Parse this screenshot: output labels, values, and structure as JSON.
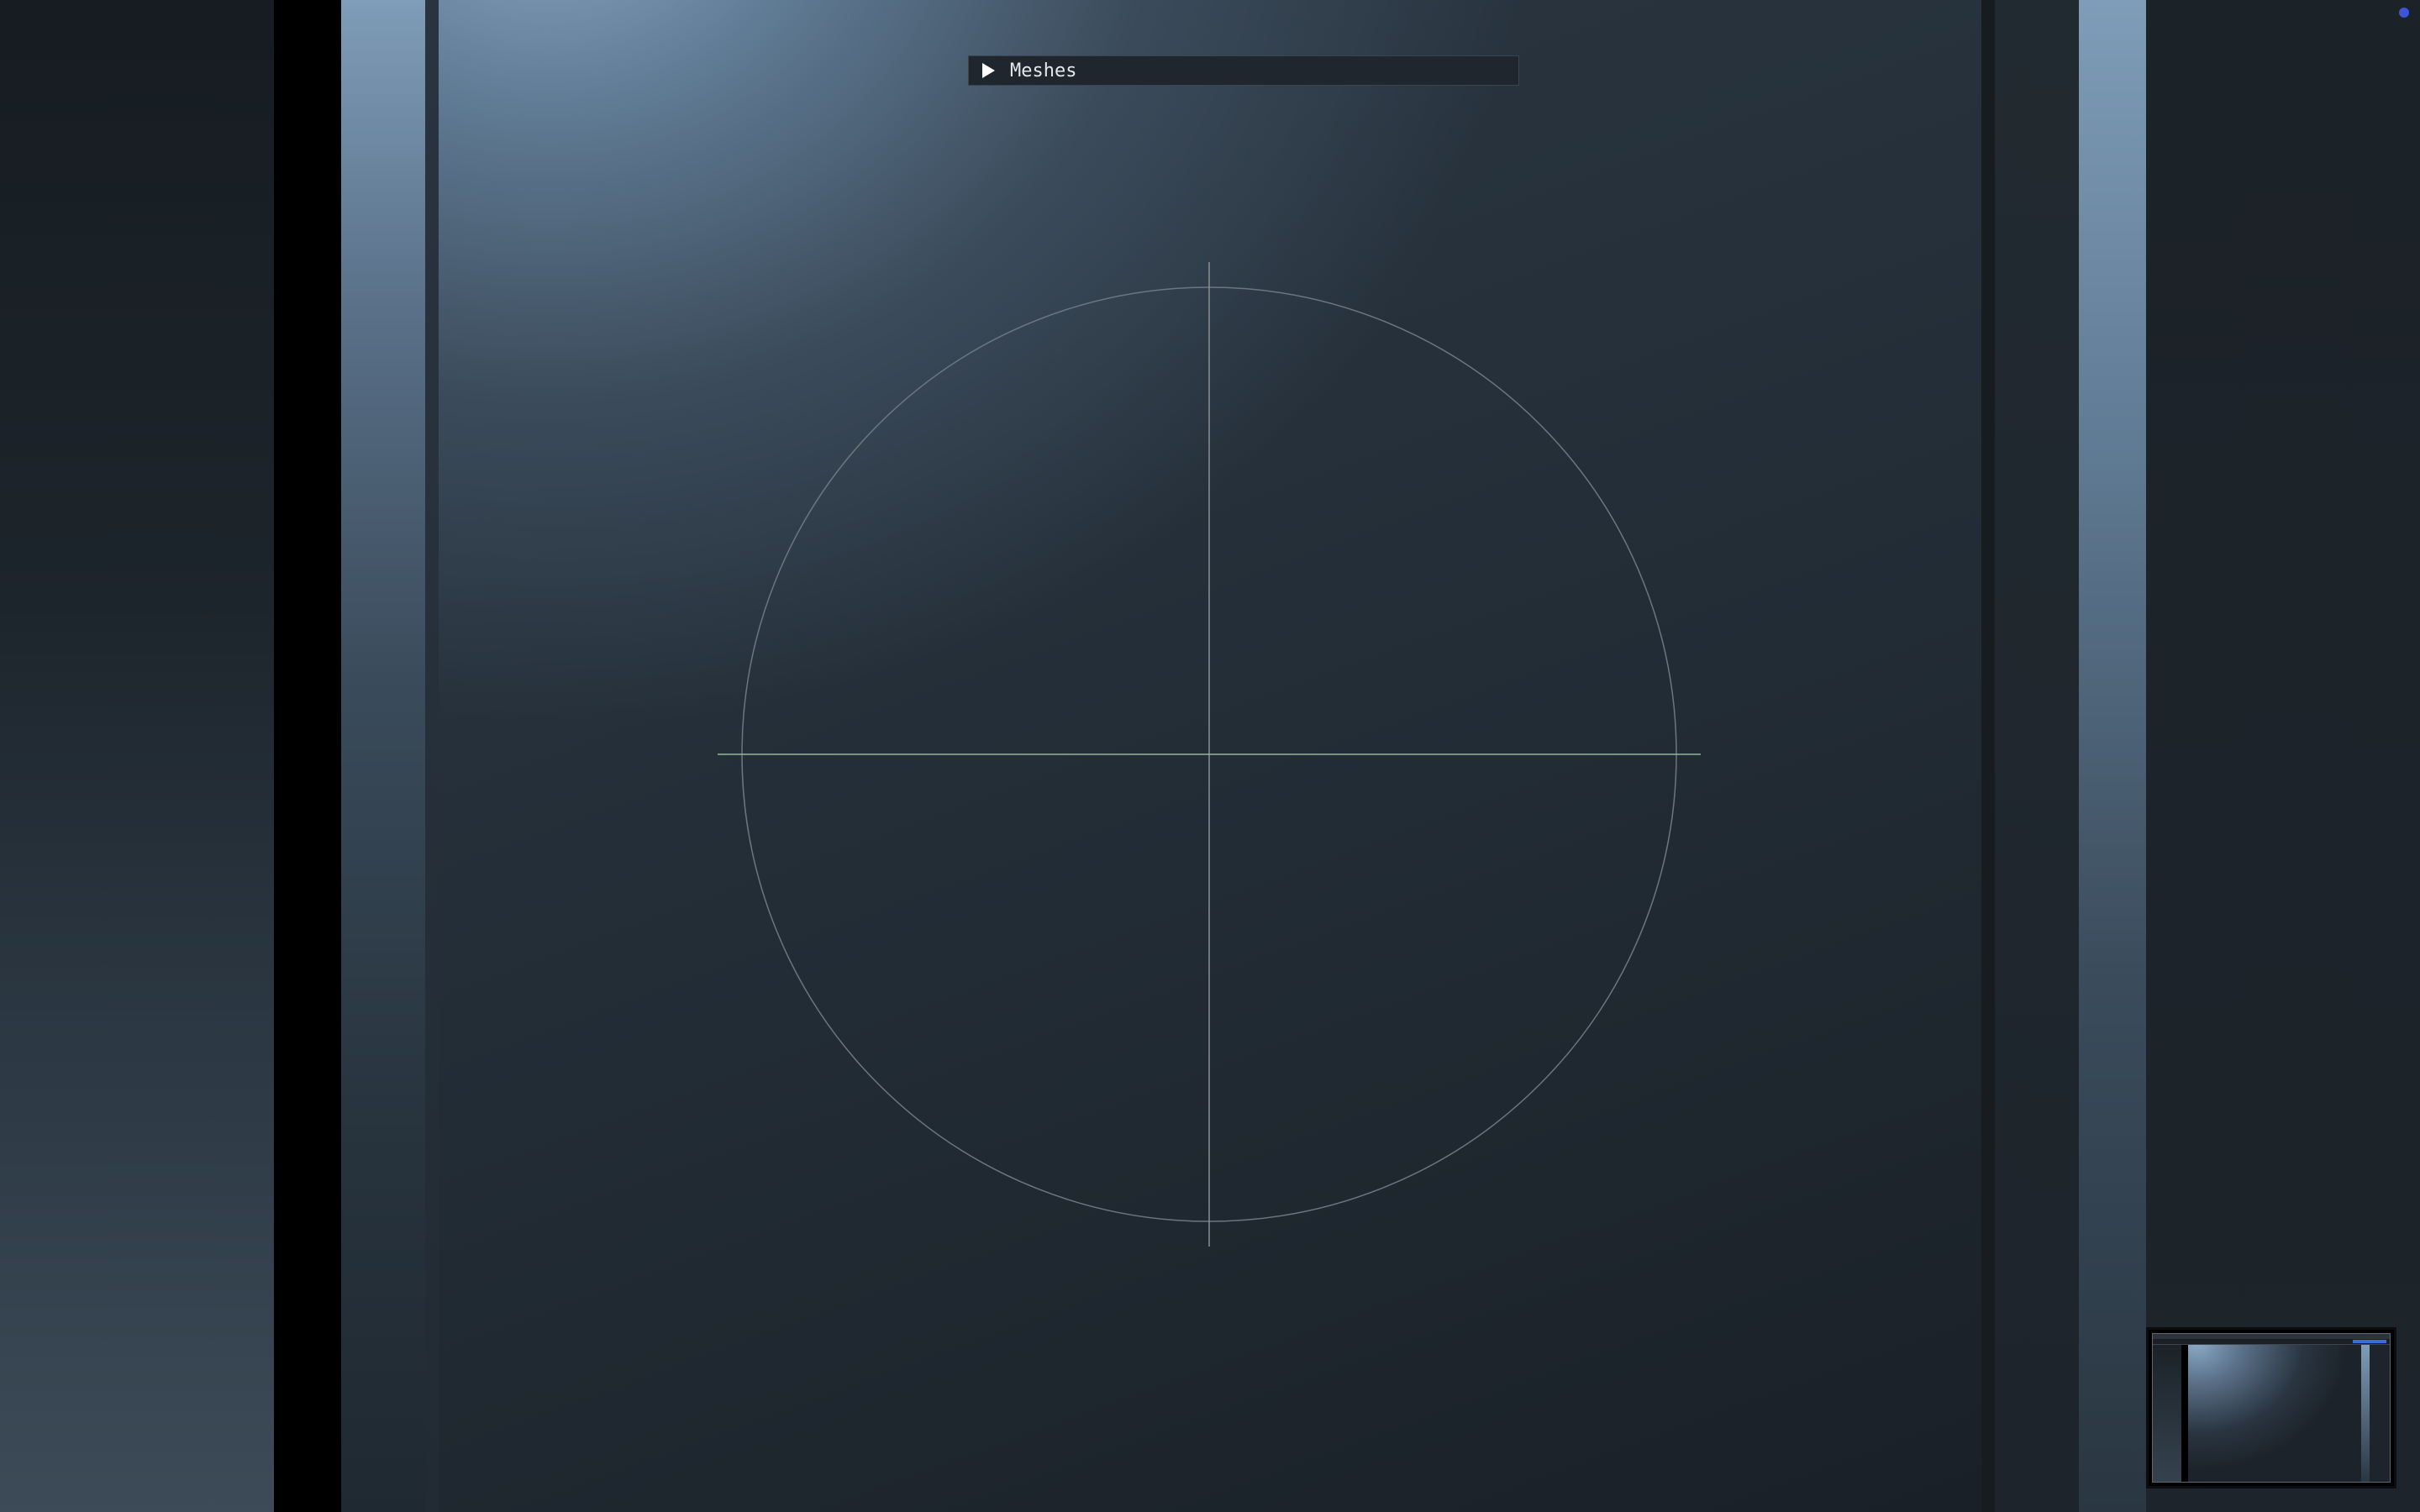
{
  "panel": {
    "title": "Meshes",
    "expand_icon": "play-triangle-icon"
  },
  "viewport": {
    "guide_circle_color": "#6b7680",
    "vertical_axis_color": "#8a8f95",
    "horizontal_axis_color": "#8fb89a"
  },
  "status_indicator": {
    "color": "#3d55d9"
  },
  "window_thumbnail": {
    "accent": "#3b6bd6"
  }
}
